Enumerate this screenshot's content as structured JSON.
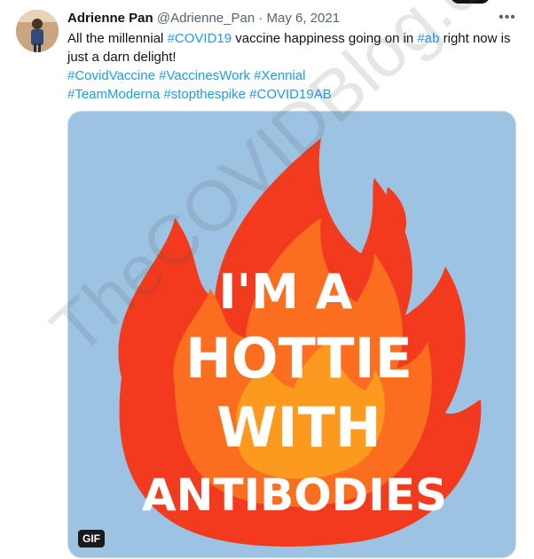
{
  "tweet": {
    "author_name": "Adrienne Pan",
    "author_handle": "@Adrienne_Pan",
    "separator": "·",
    "date": "May 6, 2021",
    "more_icon": "more-horizontal-icon",
    "text_parts": {
      "p1": "All the millennial ",
      "tag1": "#COVID19",
      "p2": " vaccine happiness going on in ",
      "tag2": "#ab",
      "p3": " right now is just a darn delight!",
      "tag3": "#CovidVaccine",
      "tag4": "#VaccinesWork",
      "tag5": "#Xennial",
      "tag6": "#TeamModerna",
      "tag7": "#stopthespike",
      "tag8": "#COVID19AB"
    },
    "media": {
      "line1": "I'M A",
      "line2": "HOTTIE",
      "line3": "WITH",
      "line4": "ANTIBODIES",
      "badge": "GIF",
      "colors": {
        "background": "#9dc3e3",
        "flame_outer": "#f23b1e",
        "flame_mid": "#fb6d1f",
        "flame_inner": "#fc9a1f"
      }
    }
  },
  "watermark": "TheCOVIDBlog.com"
}
